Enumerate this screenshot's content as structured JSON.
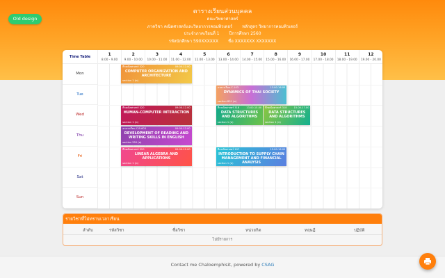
{
  "old_design_label": "Old design",
  "header": {
    "title": "ตารางเรียนส่วนบุคคล",
    "faculty": "คณะวิทยาศาสตร์",
    "department": "ภาควิชา คณิตศาสตร์และวิทยาการคอมพิวเตอร์",
    "program": "หลักสูตร วิทยาการคอมพิวเตอร์",
    "semester": "ประจำภาคเรียนที่ 1",
    "year": "ปีการศึกษา 2560",
    "student_id": "รหัสนักศึกษา 590XXXXXX",
    "student_name": "ชื่อ XXXXXXX XXXXXXX"
  },
  "timetable": {
    "corner_label": "Time Table",
    "columns": [
      {
        "n": "1",
        "range": "8.00 - 9.00"
      },
      {
        "n": "2",
        "range": "9.00 - 10.00"
      },
      {
        "n": "3",
        "range": "10.00 - 11.00"
      },
      {
        "n": "4",
        "range": "11.00 - 12.00"
      },
      {
        "n": "5",
        "range": "12.00 - 13.00"
      },
      {
        "n": "6",
        "range": "13.00 - 14.00"
      },
      {
        "n": "7",
        "range": "14.00 - 15.00"
      },
      {
        "n": "8",
        "range": "15.00 - 16.00"
      },
      {
        "n": "9",
        "range": "16.00 - 17.00"
      },
      {
        "n": "10",
        "range": "17.00 - 18.00"
      },
      {
        "n": "11",
        "range": "18.00 - 19.00"
      },
      {
        "n": "12",
        "range": "19.00 - 20.00"
      }
    ],
    "days": [
      {
        "label": "Mon",
        "color": "#333333"
      },
      {
        "label": "Tue",
        "color": "#1565c0"
      },
      {
        "label": "Wed",
        "color": "#b71c1c"
      },
      {
        "label": "Thu",
        "color": "#6a1b9a"
      },
      {
        "label": "Fri",
        "color": "#e65100"
      },
      {
        "label": "Sat",
        "color": "#1a237e"
      },
      {
        "label": "Sun",
        "color": "#b71c1c"
      }
    ],
    "events": [
      {
        "day": 0,
        "start": 9,
        "end": 12,
        "room": "ตึกคณิตศาสตร์ 320",
        "time": "09.00-12.00",
        "name": "COMPUTER ORGANIZATION AND ARCHITECTURE",
        "section": "section 1 (ท)",
        "bg": "linear-gradient(120deg,#f0923a,#f3c948)"
      },
      {
        "day": 1,
        "start": 13,
        "end": 16,
        "room": "อาคารเรียน-C-103",
        "time": "13.00-16.00",
        "name": "DYNAMICS OF THAI SOCIETY",
        "section": "section 801 (ท)",
        "bg": "linear-gradient(90deg,#f4a162,#c86fd6,#4bbfd1)"
      },
      {
        "day": 2,
        "start": 9,
        "end": 12,
        "room": "ตึกคณิตศาสตร์ 320",
        "time": "09.00-12.00",
        "name": "HUMAN-COMPUTER INTERACTION",
        "section": "section 1 (ท)",
        "bg": "linear-gradient(120deg,#c2185b,#b8323a)"
      },
      {
        "day": 2,
        "start": 13,
        "end": 15,
        "room": "ตึกคณิตศาสตร์ 318",
        "time": "13.00-15.00",
        "name": "DATA STRUCTURES AND ALGORITHMS",
        "section": "section 1 (ท)",
        "bg": "linear-gradient(120deg,#11a88a,#6cc24a)"
      },
      {
        "day": 2,
        "start": 15,
        "end": 17,
        "room": "ตึกคณิตศาสตร์ 318",
        "time": "15.00-17.00",
        "name": "DATA STRUCTURES AND ALGORITHMS",
        "section": "section 1 (ป)",
        "bg": "linear-gradient(120deg,#8dc63f,#14b08f)"
      },
      {
        "day": 3,
        "start": 9,
        "end": 12,
        "room": "อาคารเรียน-C-B-603",
        "time": "09.00-12.00",
        "name": "DEVELOPMENT OF READING AND WRITING SKILLS IN ENGLISH",
        "section": "section 550 (ท)",
        "bg": "linear-gradient(120deg,#8e44ad,#c748d0)"
      },
      {
        "day": 4,
        "start": 9,
        "end": 12,
        "room": "ตึกคณิตศาสตร์ 320",
        "time": "09.00-12.00",
        "name": "LINEAR ALGEBRA AND APPLICATIONS",
        "section": "section 1 (ท)",
        "bg": "linear-gradient(120deg,#f0478f,#ff5347)"
      },
      {
        "day": 4,
        "start": 13,
        "end": 16,
        "room": "ตึกคณิตศาสตร์ 107",
        "time": "13.00-16.00",
        "name": "INTRODUCTION TO SUPPLY CHAIN MANAGEMENT AND FINANCIAL ANALYSIS",
        "section": "section 1 (ท)",
        "bg": "linear-gradient(120deg,#28c4d6,#5b7fe0)"
      }
    ]
  },
  "unscheduled": {
    "title": "รายวิชาที่ไม่ทราบเวลาเรียน",
    "columns": [
      "ลำดับ",
      "รหัสวิชา",
      "ชื่อวิชา",
      "หน่วยกิต",
      "ทฤษฎี",
      "ปฏิบัติ"
    ],
    "empty": "ไม่มีรายการ"
  },
  "footer": {
    "prefix": "Contact me ",
    "author": "Chaloemphisit",
    "mid": ", powered by ",
    "org": "CSAG"
  }
}
